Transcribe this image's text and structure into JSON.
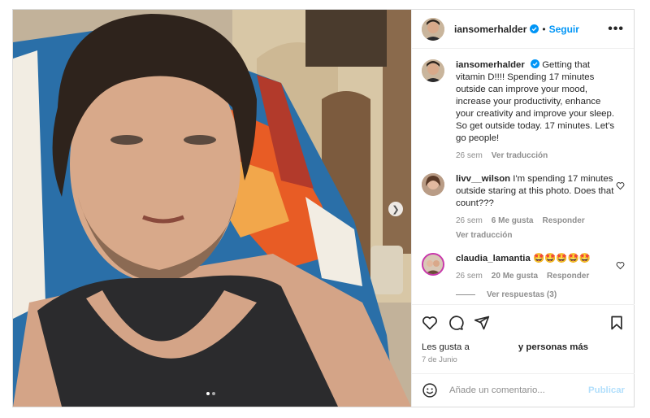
{
  "post": {
    "username": "iansomerhalder",
    "separator": "•",
    "follow_label": "Seguir",
    "more_label": "•••",
    "caption": {
      "username": "iansomerhalder",
      "text": "Getting that vitamin D!!!! Spending 17 minutes outside can improve your mood, increase your productivity, enhance your creativity and improve your sleep. So get outside today. 17 minutes. Let's go people!",
      "time": "26 sem",
      "translate": "Ver traducción"
    },
    "comments": [
      {
        "username": "livv__wilson",
        "text": "I'm spending 17 minutes outside staring at this photo. Does that count???",
        "time": "26 sem",
        "likes": "6 Me gusta",
        "reply": "Responder",
        "translate": "Ver traducción"
      },
      {
        "username": "claudia_lamantia",
        "text": "🤩🤩🤩🤩🤩",
        "time": "26 sem",
        "likes": "20 Me gusta",
        "reply": "Responder",
        "view_replies": "Ver respuestas (3)"
      }
    ],
    "likes_prefix": "Les gusta a",
    "likes_suffix": "y personas más",
    "date": "7 de Junio",
    "comment_placeholder": "Añade un comentario...",
    "publish_label": "Publicar",
    "carousel": {
      "slides": 2,
      "active": 1
    },
    "colors": {
      "accent": "#0095f6",
      "publish_disabled": "#b2dffc",
      "muted": "#8e8e8e"
    },
    "icons": [
      "heart-icon",
      "comment-icon",
      "share-icon",
      "bookmark-icon",
      "emoji-icon",
      "verified-icon",
      "more-icon",
      "next-arrow-icon"
    ]
  }
}
